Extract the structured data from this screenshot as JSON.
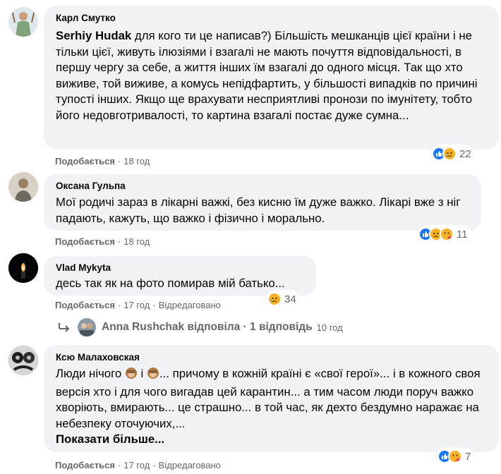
{
  "comments": [
    {
      "author": "Карл Смутко",
      "mention": "Serhiy Hudak",
      "text": " для кого ти це написав?) Більшість мешканців цієї країни і не тільки цієї, живуть ілюзіями і взагалі не мають почуття відповідальності, в першу чергу за себе, а життя інших їм взагалі до одного місця. Так що хто виживе, той виживе, а комусь непідфартить, у більшості випадків по причині тупості інших. Якщо ще врахувати несприятливі пронози по імунітету, тобто його недовготривалості, то картина взагалі постає дуже сумна...",
      "like_label": "Подобається",
      "time": "18 год",
      "reaction_count": "22"
    },
    {
      "author": "Оксана Гульпа",
      "text": "Мої родичі зараз в лікарні важкі, без кисню їм дуже важко. Лікарі вже з ніг падають, кажуть, що важко і фізично і морально.",
      "like_label": "Подобається",
      "time": "18 год",
      "reaction_count": "11"
    },
    {
      "author": "Vlad Mykyta",
      "text": "десь так як на фото помирав мій батько...",
      "like_label": "Подобається",
      "time": "17 год",
      "edited": "Відредаговано",
      "reaction_count": "34"
    },
    {
      "author": "Ксю Малаховская",
      "text_a": "Люди нічого ",
      "text_b": " і ",
      "text_c": "... причому в кожній країні є «свої герої»... і в кожного своя версія хто і для чого вигадав цей карантин... а тим часом люди поруч важко хворіють, вмирають... це страшно... в той час, як дехто бездумно наражає на небезпеку оточуючих,...",
      "show_more": "Показати більше...",
      "like_label": "Подобається",
      "time": "17 год",
      "edited": "Відредаговано",
      "reaction_count": "7"
    }
  ],
  "reply": {
    "text": "Anna Rushchak відповіла · 1 відповідь",
    "time": "10 год"
  },
  "separator": "·",
  "colors": {
    "bubble": "#f0f2f5",
    "meta": "#65676b",
    "like_blue": "#1877f2",
    "emoji_yellow": "#f7b125"
  }
}
